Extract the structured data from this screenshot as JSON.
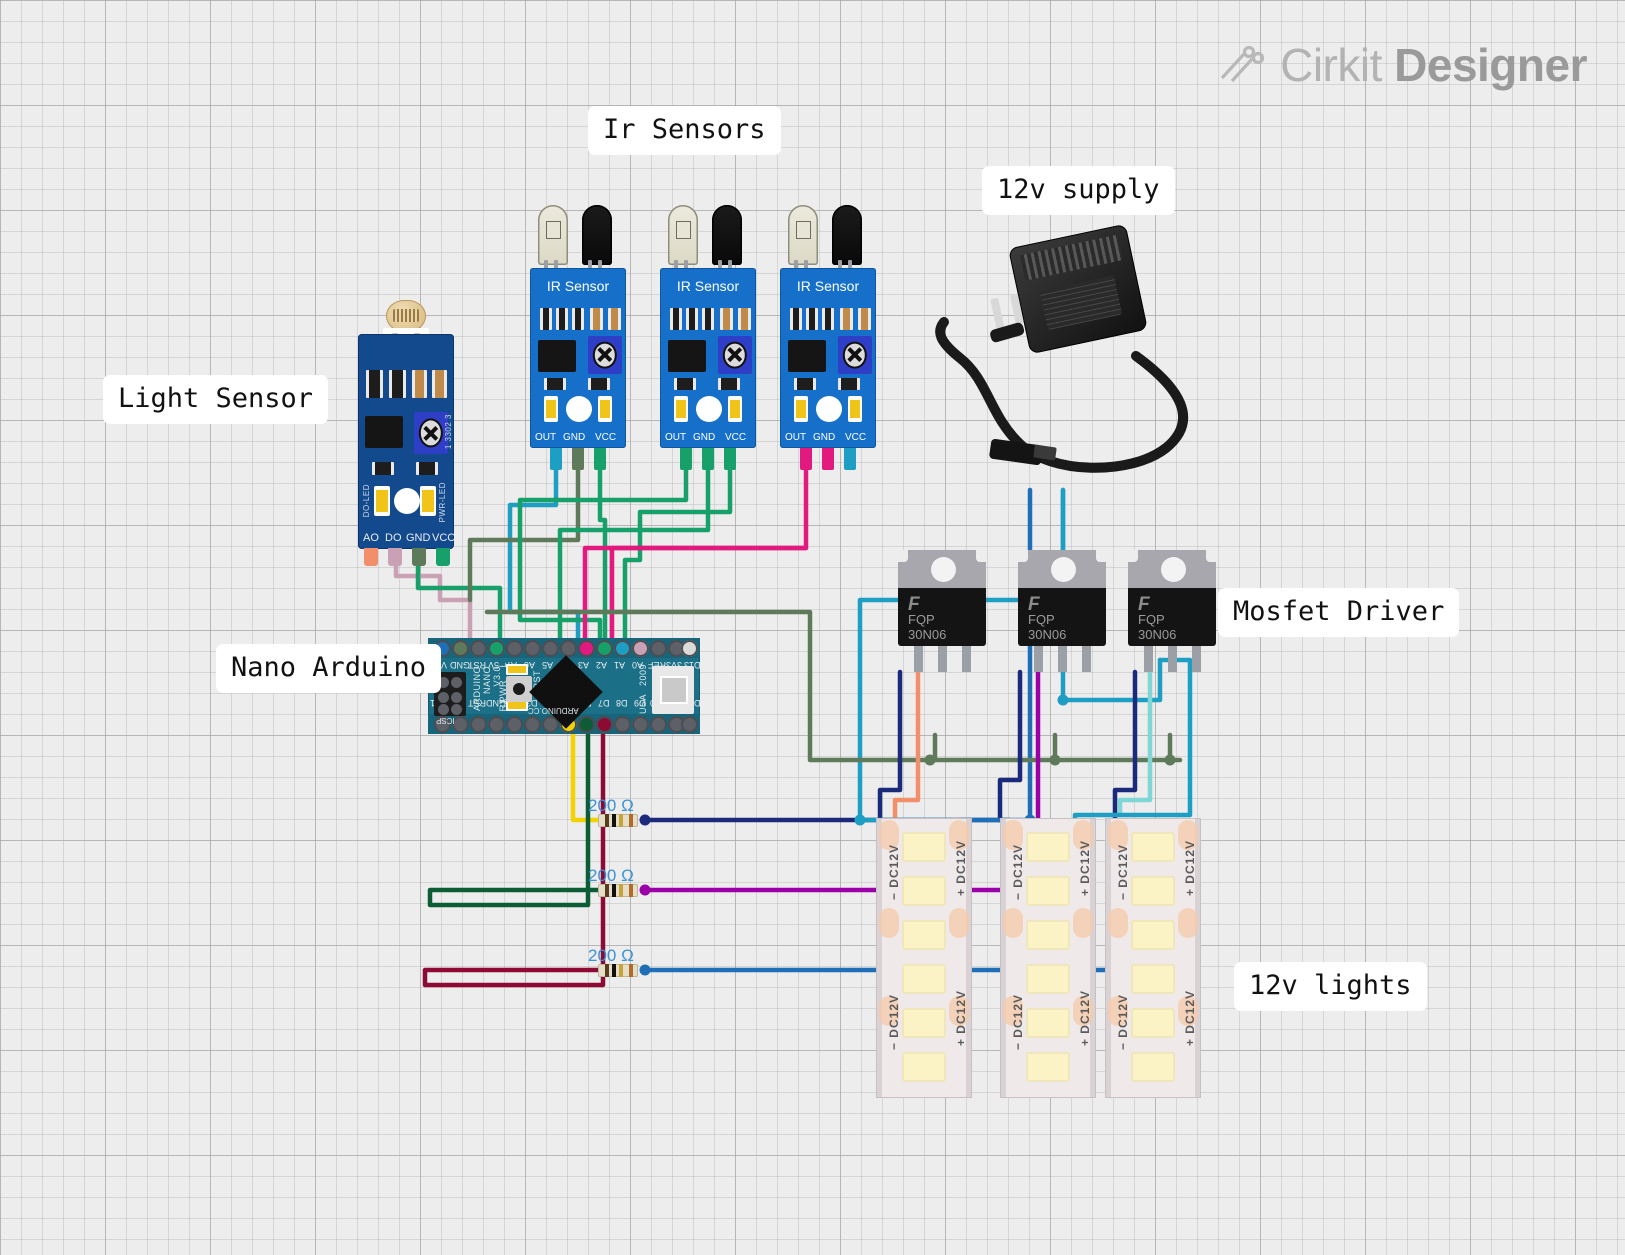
{
  "watermark": {
    "brand_light": "Cirkit",
    "brand_bold": "Designer",
    "icon": "circuit-pen-icon"
  },
  "callouts": [
    {
      "id": "ir-sensors",
      "text": "Ir Sensors"
    },
    {
      "id": "supply",
      "text": "12v supply"
    },
    {
      "id": "light-sensor",
      "text": "Light Sensor"
    },
    {
      "id": "mosfet-driver",
      "text": "Mosfet Driver"
    },
    {
      "id": "nano-arduino",
      "text": "Nano Arduino"
    },
    {
      "id": "lights",
      "text": "12v lights"
    }
  ],
  "light_sensor": {
    "name": "LDR light sensor module",
    "pins": [
      "AO",
      "DO",
      "GND",
      "VCC"
    ],
    "silk": {
      "do_led": "DO-LED",
      "pwr_led": "PWR-LED",
      "pot_code": "1 3302 3"
    }
  },
  "ir_sensors": [
    {
      "title": "IR Sensor",
      "pins": [
        "OUT",
        "GND",
        "VCC"
      ]
    },
    {
      "title": "IR Sensor",
      "pins": [
        "OUT",
        "GND",
        "VCC"
      ]
    },
    {
      "title": "IR Sensor",
      "pins": [
        "OUT",
        "GND",
        "VCC"
      ]
    }
  ],
  "mosfets": [
    {
      "brand": "F",
      "line1": "FQP",
      "line2": "30N06"
    },
    {
      "brand": "F",
      "line1": "FQP",
      "line2": "30N06"
    },
    {
      "brand": "F",
      "line1": "FQP",
      "line2": "30N06"
    }
  ],
  "resistors": [
    {
      "value": "200 Ω"
    },
    {
      "value": "200 Ω"
    },
    {
      "value": "200 Ω"
    }
  ],
  "led_strips": [
    {
      "minus": "− DC12V",
      "plus": "+ DC12V"
    },
    {
      "minus": "− DC12V",
      "plus": "+ DC12V"
    },
    {
      "minus": "− DC12V",
      "plus": "+ DC12V"
    }
  ],
  "arduino": {
    "silk_name": "ARDUINO",
    "silk_model": "NANO",
    "silk_rev": "V3.0",
    "silk_cc": "ARDUINO.CC",
    "silk_year": "2009",
    "silk_country": "USA",
    "silk_icsp": "ICSP",
    "silk_rst": "RST",
    "silk_pwr": "PWR",
    "silk_rx": "RX",
    "silk_tx": "TX",
    "silk_l": "L",
    "top_pins": [
      "VIN",
      "GND",
      "RST",
      "5V",
      "A7",
      "A6",
      "A5",
      "A4",
      "A3",
      "A2",
      "A1",
      "A0",
      "REF",
      "3V3",
      "D13"
    ],
    "bottom_pins": [
      "TX1",
      "RX1",
      "RST",
      "GND",
      "D2",
      "D3",
      "D4",
      "D5",
      "D6",
      "D7",
      "D8",
      "D9",
      "D10",
      "D11",
      "D12"
    ]
  },
  "power_supply": {
    "name": "12V DC wall adapter",
    "plug": "barrel-jack"
  },
  "colors": {
    "board_blue": "#1670c9",
    "nano_teal": "#1b6f86",
    "wire_teal": "#1f9ec4",
    "wire_green": "#18a06a",
    "wire_magenta": "#e2197f",
    "wire_pink": "#c9a0b4",
    "wire_olive": "#5f7a5a",
    "wire_navy": "#1b2a7a",
    "wire_yellow": "#f2d300",
    "wire_darkgreen": "#0c5c36",
    "wire_maroon": "#8c0a33",
    "wire_purple": "#9b00a8",
    "wire_blue": "#1f6fb8",
    "wire_salmon": "#f28f6a",
    "wire_cyan": "#7fd6d6",
    "resistor_label": "#3b93d6"
  }
}
